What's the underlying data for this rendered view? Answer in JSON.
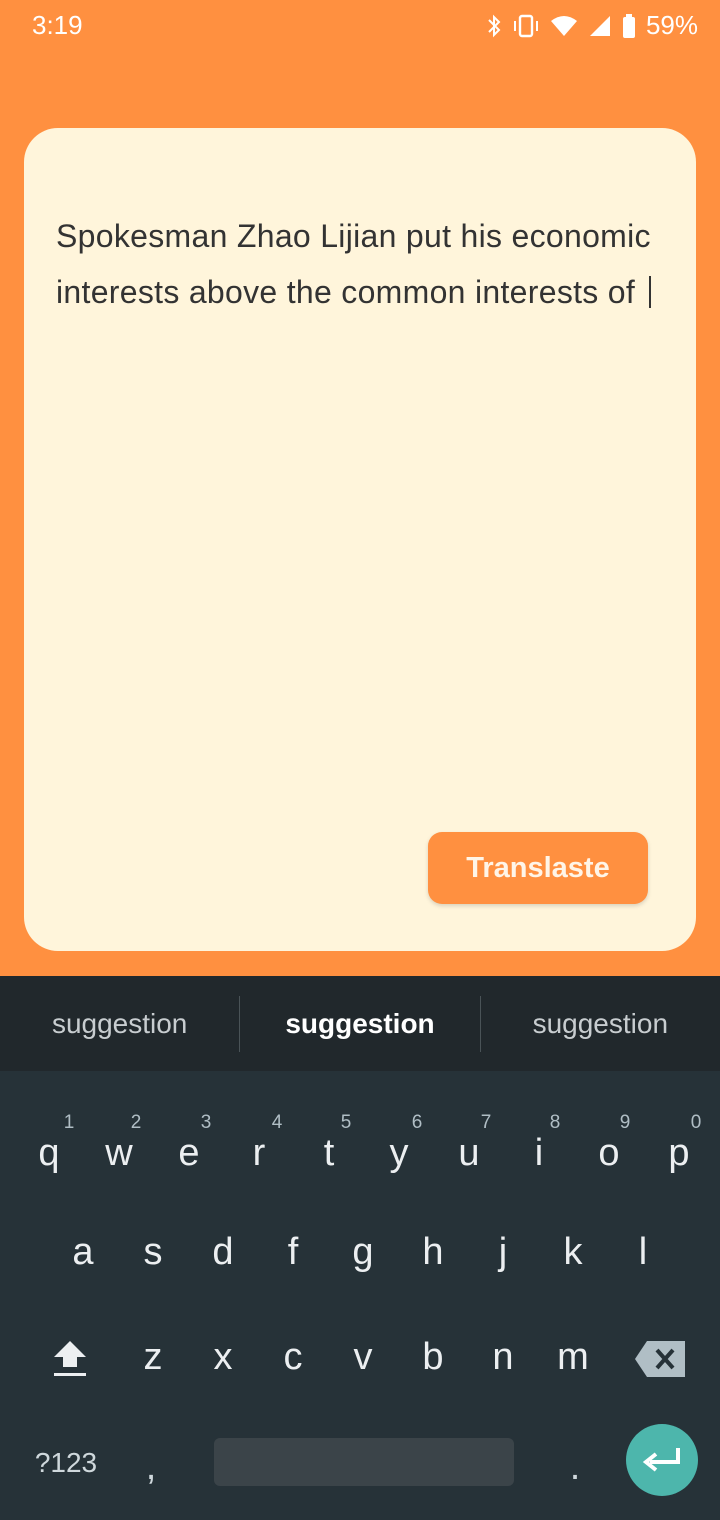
{
  "status_bar": {
    "time": "3:19",
    "battery": "59%",
    "icons": [
      "bluetooth-icon",
      "vibrate-icon",
      "wifi-icon",
      "signal-icon",
      "battery-icon"
    ]
  },
  "editor": {
    "text": "Spokesman Zhao Lijian put his economic interests above the common interests of",
    "translate_label": "Translaste"
  },
  "keyboard": {
    "suggestions": [
      "suggestion",
      "suggestion",
      "suggestion"
    ],
    "row1": [
      "q",
      "w",
      "e",
      "r",
      "t",
      "y",
      "u",
      "i",
      "o",
      "p"
    ],
    "row1_hints": [
      "1",
      "2",
      "3",
      "4",
      "5",
      "6",
      "7",
      "8",
      "9",
      "0"
    ],
    "row2": [
      "a",
      "s",
      "d",
      "f",
      "g",
      "h",
      "j",
      "k",
      "l"
    ],
    "row3": [
      "z",
      "x",
      "c",
      "v",
      "b",
      "n",
      "m"
    ],
    "symbols_label": "?123",
    "comma": ",",
    "period": "."
  },
  "colors": {
    "accent": "#FF9040",
    "card_bg": "#FFF5DB",
    "keyboard_bg": "#263238",
    "enter_key": "#4DB6AC"
  }
}
